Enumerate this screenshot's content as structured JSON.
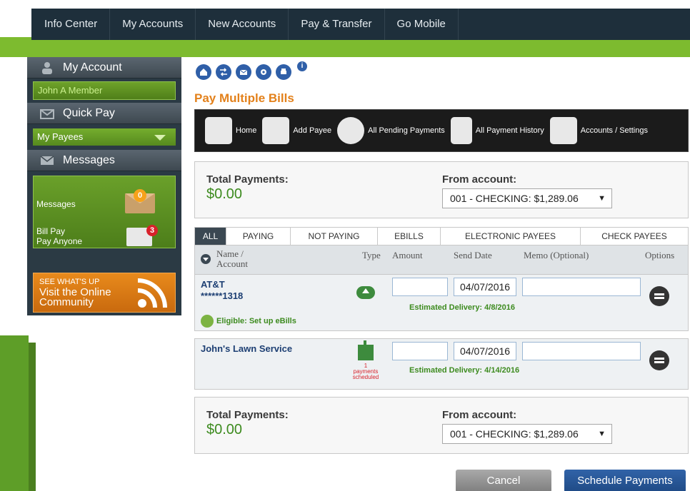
{
  "nav": [
    "Info Center",
    "My Accounts",
    "New Accounts",
    "Pay & Transfer",
    "Go Mobile"
  ],
  "sidebar": {
    "my_account": "My Account",
    "member": "John A Member",
    "quick_pay": "Quick Pay",
    "payees_select": "My Payees",
    "messages_head": "Messages",
    "messages_label": "Messages",
    "messages_count": "0",
    "billpay_line1": "Bill Pay",
    "billpay_line2": "Pay Anyone",
    "billpay_count": "3",
    "community_l1": "SEE WHAT'S UP",
    "community_l2": "Visit the Online",
    "community_l3": "Community"
  },
  "page_title": "Pay Multiple Bills",
  "toolbar": [
    "Home",
    "Add Payee",
    "All Pending Payments",
    "All Payment History",
    "Accounts / Settings"
  ],
  "summary": {
    "total_label": "Total Payments:",
    "total_amount": "$0.00",
    "from_label": "From account:",
    "from_value": "001 - CHECKING: $1,289.06"
  },
  "tabs": [
    "ALL",
    "PAYING",
    "NOT PAYING",
    "EBILLS",
    "ELECTRONIC PAYEES",
    "CHECK PAYEES"
  ],
  "columns": {
    "name": "Name /",
    "name2": "Account",
    "type": "Type",
    "amount": "Amount",
    "send_date": "Send Date",
    "memo": "Memo (Optional)",
    "options": "Options"
  },
  "payees": [
    {
      "name": "AT&T",
      "account": "******1318",
      "send_date": "04/07/2016",
      "estimated": "Estimated Delivery: 4/8/2016",
      "ebill": "Eligible: Set up eBills"
    },
    {
      "name": "John's Lawn Service",
      "send_date": "04/07/2016",
      "estimated": "Estimated Delivery: 4/14/2016",
      "scheduled_l1": "1",
      "scheduled_l2": "payments",
      "scheduled_l3": "scheduled"
    }
  ],
  "buttons": {
    "cancel": "Cancel",
    "schedule": "Schedule Payments"
  },
  "colors": {
    "accent_orange": "#e3811b",
    "green": "#3d8b1f",
    "nav": "#1e2f3b",
    "primary_blue": "#1f4a85"
  }
}
